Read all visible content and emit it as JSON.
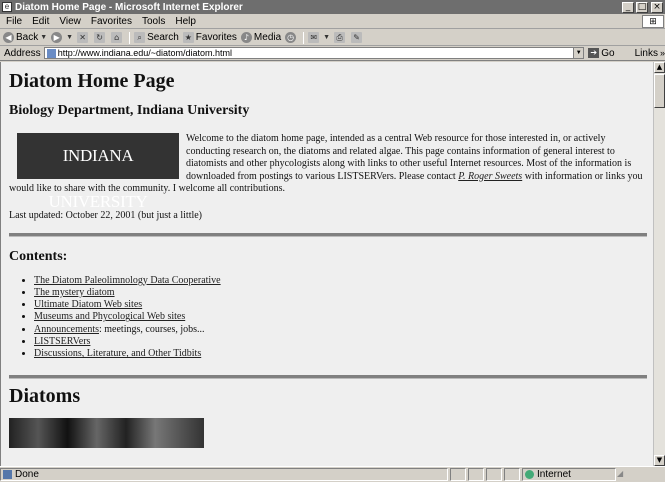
{
  "window": {
    "title": "Diatom Home Page - Microsoft Internet Explorer",
    "min": "_",
    "max": "□",
    "close": "×"
  },
  "menu": [
    "File",
    "Edit",
    "View",
    "Favorites",
    "Tools",
    "Help"
  ],
  "toolbar": {
    "back": "Back",
    "search": "Search",
    "favorites": "Favorites",
    "media": "Media"
  },
  "address": {
    "label": "Address",
    "url": "http://www.indiana.edu/~diatom/diatom.html",
    "go": "Go",
    "links": "Links"
  },
  "page": {
    "heading": "Diatom Home Page",
    "subheading": "Biology Department, Indiana University",
    "logo_text": "INDIANA UNIVERSITY",
    "intro_text": "Welcome to the diatom home page, intended as a central Web resource for those interested in, or actively conducting research on, the diatoms and related algae. This page contains information of general interest to diatomists and other phycologists along with links to other useful Internet resources. Most of the information is downloaded from postings to various LISTSERVers. Please contact",
    "contact_link": "P. Roger Sweets",
    "intro_tail": "with information or links you would like to share with the community. I welcome all contributions.",
    "last_updated": "Last updated: October 22, 2001 (but just a little)",
    "contents_heading": "Contents:",
    "contents": [
      {
        "link": "The Diatom Paleolimnology Data Cooperative",
        "extra": ""
      },
      {
        "link": "The mystery diatom",
        "extra": ""
      },
      {
        "link": "Ultimate Diatom Web sites",
        "extra": ""
      },
      {
        "link": "Museums and Phycological Web sites",
        "extra": ""
      },
      {
        "link": "Announcements",
        "extra": ": meetings, courses, jobs..."
      },
      {
        "link": "LISTSERVers",
        "extra": ""
      },
      {
        "link": "Discussions, Literature, and Other Tidbits",
        "extra": ""
      }
    ],
    "diatoms_heading": "Diatoms"
  },
  "status": {
    "text": "Done",
    "zone": "Internet"
  }
}
